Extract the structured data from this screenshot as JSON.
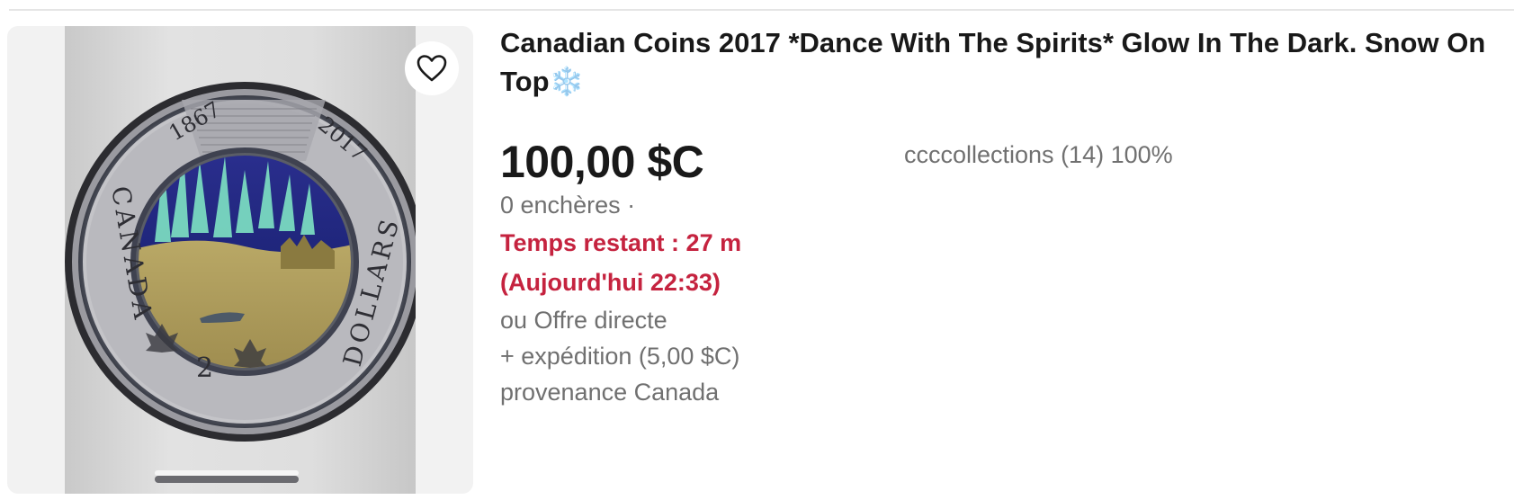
{
  "listing": {
    "title": "Canadian Coins 2017 *Dance With The Spirits* Glow In The Dark. Snow On Top❄️",
    "price": "100,00 $C",
    "bids": "0 enchères ·",
    "time_left": "Temps restant : 27 m",
    "end_time": "(Aujourd'hui 22:33)",
    "buy_option": "ou Offre directe",
    "shipping": "+ expédition (5,00 $C)",
    "origin": "provenance Canada",
    "seller": "ccccollections (14) 100%",
    "favorite_icon": "heart-outline-icon"
  },
  "coin": {
    "year_left": "1867",
    "year_right": "2017",
    "country": "CANADA",
    "denomination": "DOLLARS",
    "numeral": "2"
  },
  "colors": {
    "price_text": "#191919",
    "urgent_text": "#c5233f",
    "secondary_text": "#707070"
  }
}
